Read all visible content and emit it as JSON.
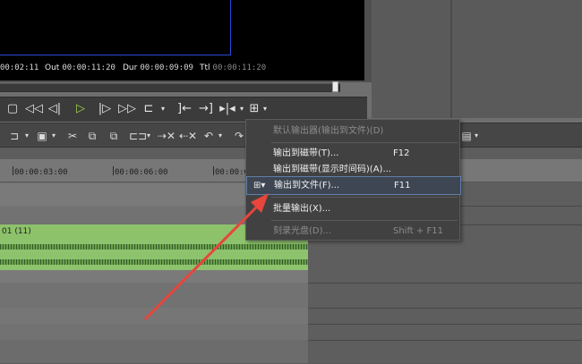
{
  "timecodes": {
    "current": "00:02:11",
    "out_label": "Out",
    "out_value": "00:00:11:20",
    "dur_label": "Dur",
    "dur_value": "00:00:09:09",
    "ttl_label": "Ttl",
    "ttl_value": "00:00:11:20"
  },
  "ruler": {
    "ticks": [
      "00:00:03:00",
      "00:00:06:00",
      "00:00:09:00"
    ]
  },
  "clip": {
    "label": "01 (11)"
  },
  "menu": {
    "items": [
      {
        "label": "默认输出器(输出到文件)(D)",
        "shortcut": "",
        "disabled": true
      },
      {
        "label": "输出到磁带(T)...",
        "shortcut": "F12",
        "disabled": false
      },
      {
        "label": "输出到磁带(显示时间码)(A)...",
        "shortcut": "",
        "disabled": false
      },
      {
        "label": "输出到文件(F)...",
        "shortcut": "F11",
        "disabled": false,
        "selected": true
      },
      {
        "label": "批量输出(X)...",
        "shortcut": "",
        "disabled": false
      },
      {
        "label": "刻录光盘(D)...",
        "shortcut": "Shift + F11",
        "disabled": true
      }
    ]
  },
  "colors": {
    "clip_green": "#8dc26b",
    "arrow_red": "#e8453c",
    "play_green": "#9fd64a"
  }
}
